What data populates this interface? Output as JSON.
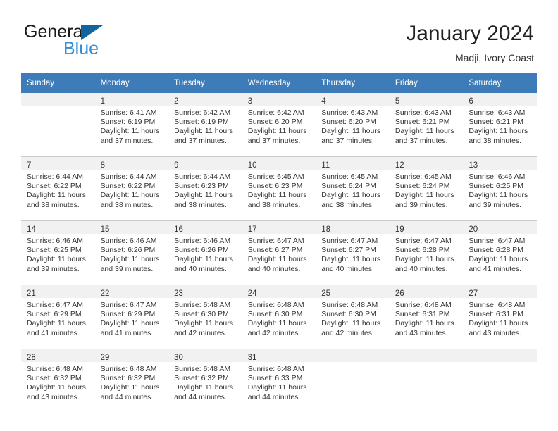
{
  "brand": {
    "name_part1": "General",
    "name_part2": "Blue",
    "triangle_color": "#10659f",
    "blue_color": "#2f8ed6"
  },
  "header": {
    "title": "January 2024",
    "subtitle": "Madji, Ivory Coast"
  },
  "theme": {
    "header_row_bg": "#3d7cb8",
    "header_row_text": "#ffffff",
    "daynum_band_bg": "#f1f1f1",
    "grid_line": "#cccccc",
    "body_text": "#333333"
  },
  "calendar": {
    "weekday_headers": [
      "Sunday",
      "Monday",
      "Tuesday",
      "Wednesday",
      "Thursday",
      "Friday",
      "Saturday"
    ],
    "weeks": [
      [
        {
          "day": "",
          "sunrise": "",
          "sunset": "",
          "daylight1": "",
          "daylight2": ""
        },
        {
          "day": "1",
          "sunrise": "Sunrise: 6:41 AM",
          "sunset": "Sunset: 6:19 PM",
          "daylight1": "Daylight: 11 hours",
          "daylight2": "and 37 minutes."
        },
        {
          "day": "2",
          "sunrise": "Sunrise: 6:42 AM",
          "sunset": "Sunset: 6:19 PM",
          "daylight1": "Daylight: 11 hours",
          "daylight2": "and 37 minutes."
        },
        {
          "day": "3",
          "sunrise": "Sunrise: 6:42 AM",
          "sunset": "Sunset: 6:20 PM",
          "daylight1": "Daylight: 11 hours",
          "daylight2": "and 37 minutes."
        },
        {
          "day": "4",
          "sunrise": "Sunrise: 6:43 AM",
          "sunset": "Sunset: 6:20 PM",
          "daylight1": "Daylight: 11 hours",
          "daylight2": "and 37 minutes."
        },
        {
          "day": "5",
          "sunrise": "Sunrise: 6:43 AM",
          "sunset": "Sunset: 6:21 PM",
          "daylight1": "Daylight: 11 hours",
          "daylight2": "and 37 minutes."
        },
        {
          "day": "6",
          "sunrise": "Sunrise: 6:43 AM",
          "sunset": "Sunset: 6:21 PM",
          "daylight1": "Daylight: 11 hours",
          "daylight2": "and 38 minutes."
        }
      ],
      [
        {
          "day": "7",
          "sunrise": "Sunrise: 6:44 AM",
          "sunset": "Sunset: 6:22 PM",
          "daylight1": "Daylight: 11 hours",
          "daylight2": "and 38 minutes."
        },
        {
          "day": "8",
          "sunrise": "Sunrise: 6:44 AM",
          "sunset": "Sunset: 6:22 PM",
          "daylight1": "Daylight: 11 hours",
          "daylight2": "and 38 minutes."
        },
        {
          "day": "9",
          "sunrise": "Sunrise: 6:44 AM",
          "sunset": "Sunset: 6:23 PM",
          "daylight1": "Daylight: 11 hours",
          "daylight2": "and 38 minutes."
        },
        {
          "day": "10",
          "sunrise": "Sunrise: 6:45 AM",
          "sunset": "Sunset: 6:23 PM",
          "daylight1": "Daylight: 11 hours",
          "daylight2": "and 38 minutes."
        },
        {
          "day": "11",
          "sunrise": "Sunrise: 6:45 AM",
          "sunset": "Sunset: 6:24 PM",
          "daylight1": "Daylight: 11 hours",
          "daylight2": "and 38 minutes."
        },
        {
          "day": "12",
          "sunrise": "Sunrise: 6:45 AM",
          "sunset": "Sunset: 6:24 PM",
          "daylight1": "Daylight: 11 hours",
          "daylight2": "and 39 minutes."
        },
        {
          "day": "13",
          "sunrise": "Sunrise: 6:46 AM",
          "sunset": "Sunset: 6:25 PM",
          "daylight1": "Daylight: 11 hours",
          "daylight2": "and 39 minutes."
        }
      ],
      [
        {
          "day": "14",
          "sunrise": "Sunrise: 6:46 AM",
          "sunset": "Sunset: 6:25 PM",
          "daylight1": "Daylight: 11 hours",
          "daylight2": "and 39 minutes."
        },
        {
          "day": "15",
          "sunrise": "Sunrise: 6:46 AM",
          "sunset": "Sunset: 6:26 PM",
          "daylight1": "Daylight: 11 hours",
          "daylight2": "and 39 minutes."
        },
        {
          "day": "16",
          "sunrise": "Sunrise: 6:46 AM",
          "sunset": "Sunset: 6:26 PM",
          "daylight1": "Daylight: 11 hours",
          "daylight2": "and 40 minutes."
        },
        {
          "day": "17",
          "sunrise": "Sunrise: 6:47 AM",
          "sunset": "Sunset: 6:27 PM",
          "daylight1": "Daylight: 11 hours",
          "daylight2": "and 40 minutes."
        },
        {
          "day": "18",
          "sunrise": "Sunrise: 6:47 AM",
          "sunset": "Sunset: 6:27 PM",
          "daylight1": "Daylight: 11 hours",
          "daylight2": "and 40 minutes."
        },
        {
          "day": "19",
          "sunrise": "Sunrise: 6:47 AM",
          "sunset": "Sunset: 6:28 PM",
          "daylight1": "Daylight: 11 hours",
          "daylight2": "and 40 minutes."
        },
        {
          "day": "20",
          "sunrise": "Sunrise: 6:47 AM",
          "sunset": "Sunset: 6:28 PM",
          "daylight1": "Daylight: 11 hours",
          "daylight2": "and 41 minutes."
        }
      ],
      [
        {
          "day": "21",
          "sunrise": "Sunrise: 6:47 AM",
          "sunset": "Sunset: 6:29 PM",
          "daylight1": "Daylight: 11 hours",
          "daylight2": "and 41 minutes."
        },
        {
          "day": "22",
          "sunrise": "Sunrise: 6:47 AM",
          "sunset": "Sunset: 6:29 PM",
          "daylight1": "Daylight: 11 hours",
          "daylight2": "and 41 minutes."
        },
        {
          "day": "23",
          "sunrise": "Sunrise: 6:48 AM",
          "sunset": "Sunset: 6:30 PM",
          "daylight1": "Daylight: 11 hours",
          "daylight2": "and 42 minutes."
        },
        {
          "day": "24",
          "sunrise": "Sunrise: 6:48 AM",
          "sunset": "Sunset: 6:30 PM",
          "daylight1": "Daylight: 11 hours",
          "daylight2": "and 42 minutes."
        },
        {
          "day": "25",
          "sunrise": "Sunrise: 6:48 AM",
          "sunset": "Sunset: 6:30 PM",
          "daylight1": "Daylight: 11 hours",
          "daylight2": "and 42 minutes."
        },
        {
          "day": "26",
          "sunrise": "Sunrise: 6:48 AM",
          "sunset": "Sunset: 6:31 PM",
          "daylight1": "Daylight: 11 hours",
          "daylight2": "and 43 minutes."
        },
        {
          "day": "27",
          "sunrise": "Sunrise: 6:48 AM",
          "sunset": "Sunset: 6:31 PM",
          "daylight1": "Daylight: 11 hours",
          "daylight2": "and 43 minutes."
        }
      ],
      [
        {
          "day": "28",
          "sunrise": "Sunrise: 6:48 AM",
          "sunset": "Sunset: 6:32 PM",
          "daylight1": "Daylight: 11 hours",
          "daylight2": "and 43 minutes."
        },
        {
          "day": "29",
          "sunrise": "Sunrise: 6:48 AM",
          "sunset": "Sunset: 6:32 PM",
          "daylight1": "Daylight: 11 hours",
          "daylight2": "and 44 minutes."
        },
        {
          "day": "30",
          "sunrise": "Sunrise: 6:48 AM",
          "sunset": "Sunset: 6:32 PM",
          "daylight1": "Daylight: 11 hours",
          "daylight2": "and 44 minutes."
        },
        {
          "day": "31",
          "sunrise": "Sunrise: 6:48 AM",
          "sunset": "Sunset: 6:33 PM",
          "daylight1": "Daylight: 11 hours",
          "daylight2": "and 44 minutes."
        },
        {
          "day": "",
          "sunrise": "",
          "sunset": "",
          "daylight1": "",
          "daylight2": ""
        },
        {
          "day": "",
          "sunrise": "",
          "sunset": "",
          "daylight1": "",
          "daylight2": ""
        },
        {
          "day": "",
          "sunrise": "",
          "sunset": "",
          "daylight1": "",
          "daylight2": ""
        }
      ]
    ]
  }
}
